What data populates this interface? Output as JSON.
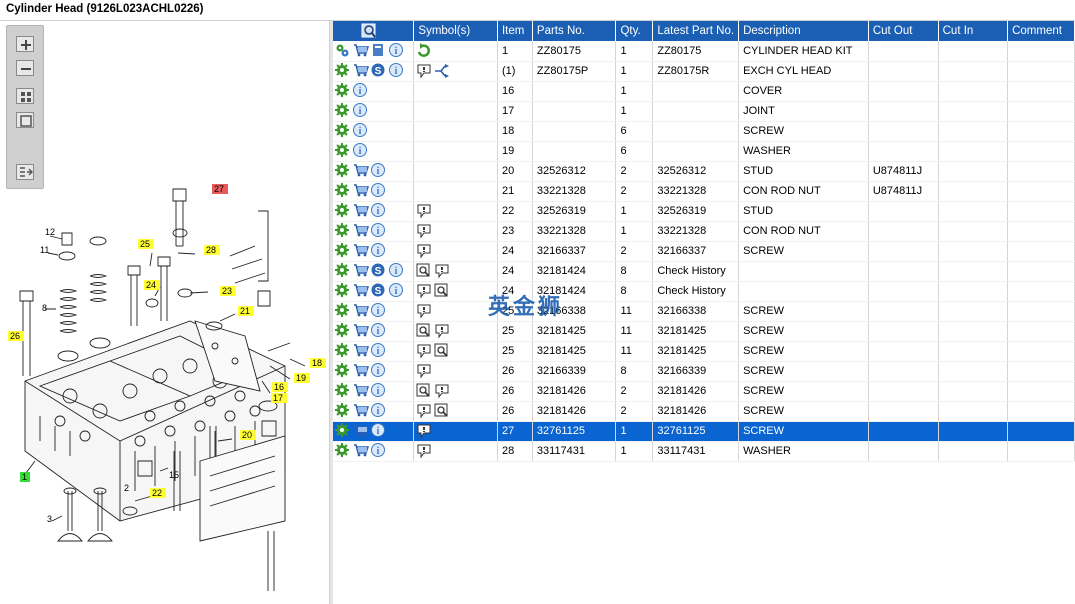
{
  "window": {
    "title": "Cylinder Head (9126L023ACHL0226)"
  },
  "toolbar": {
    "buttons": [
      {
        "name": "zoom-in-icon"
      },
      {
        "name": "zoom-out-icon"
      },
      {
        "name": "fit-all-icon"
      },
      {
        "name": "fit-window-icon"
      },
      {
        "name": "toggle-list-icon"
      }
    ]
  },
  "diagram": {
    "callouts": [
      {
        "label": "27",
        "color": "#e55a5a"
      },
      {
        "label": "12",
        "color": "none"
      },
      {
        "label": "11",
        "color": "none"
      },
      {
        "label": "25",
        "color": "#ffff33"
      },
      {
        "label": "28",
        "color": "#ffff33"
      },
      {
        "label": "24",
        "color": "#ffff33"
      },
      {
        "label": "23",
        "color": "#ffff33"
      },
      {
        "label": "8",
        "color": "none"
      },
      {
        "label": "21",
        "color": "#ffff33"
      },
      {
        "label": "26",
        "color": "#ffff33"
      },
      {
        "label": "18",
        "color": "#ffff33"
      },
      {
        "label": "19",
        "color": "#ffff33"
      },
      {
        "label": "16",
        "color": "#ffff33"
      },
      {
        "label": "17",
        "color": "#ffff33"
      },
      {
        "label": "20",
        "color": "#ffff33"
      },
      {
        "label": "15",
        "color": "none"
      },
      {
        "label": "2",
        "color": "none"
      },
      {
        "label": "22",
        "color": "#ffff33"
      },
      {
        "label": "3",
        "color": "none"
      },
      {
        "label": "1",
        "color": "#33dd33"
      }
    ]
  },
  "grid": {
    "header_icon": "magnify-icon",
    "columns": [
      "Symbol(s)",
      "Item",
      "Parts No.",
      "Qty.",
      "Latest Part No.",
      "Description",
      "Cut Out",
      "Cut In",
      "Comment"
    ],
    "rows": [
      {
        "icons": [
          "gear-kit-icon",
          "cart-icon",
          "book-icon",
          "info-icon"
        ],
        "symbols": [
          "refresh-arrow-icon"
        ],
        "item": "1",
        "part": "ZZ80175",
        "qty": "1",
        "latest": "ZZ80175",
        "desc": "CYLINDER HEAD KIT",
        "cut_out": "",
        "cut_in": "",
        "comment": ""
      },
      {
        "icons": [
          "gear-icon",
          "cart-icon",
          "s-icon",
          "info-icon"
        ],
        "symbols": [
          "note-icon",
          "branch-arrow-icon"
        ],
        "item": "(1)",
        "part": "ZZ80175P",
        "qty": "1",
        "latest": "ZZ80175R",
        "desc": "EXCH CYL HEAD",
        "cut_out": "",
        "cut_in": "",
        "comment": ""
      },
      {
        "icons": [
          "gear-icon",
          "info-icon"
        ],
        "symbols": [],
        "item": "16",
        "part": "",
        "qty": "1",
        "latest": "",
        "desc": "COVER",
        "cut_out": "",
        "cut_in": "",
        "comment": ""
      },
      {
        "icons": [
          "gear-icon",
          "info-icon"
        ],
        "symbols": [],
        "item": "17",
        "part": "",
        "qty": "1",
        "latest": "",
        "desc": "JOINT",
        "cut_out": "",
        "cut_in": "",
        "comment": ""
      },
      {
        "icons": [
          "gear-icon",
          "info-icon"
        ],
        "symbols": [],
        "item": "18",
        "part": "",
        "qty": "6",
        "latest": "",
        "desc": "SCREW",
        "cut_out": "",
        "cut_in": "",
        "comment": ""
      },
      {
        "icons": [
          "gear-icon",
          "info-icon"
        ],
        "symbols": [],
        "item": "19",
        "part": "",
        "qty": "6",
        "latest": "",
        "desc": "WASHER",
        "cut_out": "",
        "cut_in": "",
        "comment": ""
      },
      {
        "icons": [
          "gear-icon",
          "cart-icon",
          "info-icon"
        ],
        "symbols": [],
        "item": "20",
        "part": "32526312",
        "qty": "2",
        "latest": "32526312",
        "desc": "STUD",
        "cut_out": "U874811J",
        "cut_in": "",
        "comment": ""
      },
      {
        "icons": [
          "gear-icon",
          "cart-icon",
          "info-icon"
        ],
        "symbols": [],
        "item": "21",
        "part": "33221328",
        "qty": "2",
        "latest": "33221328",
        "desc": "CON ROD NUT",
        "cut_out": "U874811J",
        "cut_in": "",
        "comment": ""
      },
      {
        "icons": [
          "gear-icon",
          "cart-icon",
          "info-icon"
        ],
        "symbols": [
          "note-icon"
        ],
        "item": "22",
        "part": "32526319",
        "qty": "1",
        "latest": "32526319",
        "desc": "STUD",
        "cut_out": "",
        "cut_in": "",
        "comment": ""
      },
      {
        "icons": [
          "gear-icon",
          "cart-icon",
          "info-icon"
        ],
        "symbols": [
          "note-icon"
        ],
        "item": "23",
        "part": "33221328",
        "qty": "1",
        "latest": "33221328",
        "desc": "CON ROD NUT",
        "cut_out": "",
        "cut_in": "",
        "comment": ""
      },
      {
        "icons": [
          "gear-icon",
          "cart-icon",
          "info-icon"
        ],
        "symbols": [
          "note-icon"
        ],
        "item": "24",
        "part": "32166337",
        "qty": "2",
        "latest": "32166337",
        "desc": "SCREW",
        "cut_out": "",
        "cut_in": "",
        "comment": ""
      },
      {
        "icons": [
          "gear-icon",
          "cart-icon",
          "s-icon",
          "info-icon"
        ],
        "symbols": [
          "search-note-icon",
          "note-icon"
        ],
        "item": "24",
        "part": "32181424",
        "qty": "8",
        "latest": "Check History",
        "desc": "",
        "cut_out": "",
        "cut_in": "",
        "comment": ""
      },
      {
        "icons": [
          "gear-icon",
          "cart-icon",
          "s-icon",
          "info-icon"
        ],
        "symbols": [
          "note-icon",
          "search-note-icon"
        ],
        "item": "24",
        "part": "32181424",
        "qty": "8",
        "latest": "Check History",
        "desc": "",
        "cut_out": "",
        "cut_in": "",
        "comment": ""
      },
      {
        "icons": [
          "gear-icon",
          "cart-icon",
          "info-icon"
        ],
        "symbols": [
          "note-icon"
        ],
        "item": "25",
        "part": "32166338",
        "qty": "11",
        "latest": "32166338",
        "desc": "SCREW",
        "cut_out": "",
        "cut_in": "",
        "comment": ""
      },
      {
        "icons": [
          "gear-icon",
          "cart-icon",
          "info-icon"
        ],
        "symbols": [
          "search-note-icon",
          "note-icon"
        ],
        "item": "25",
        "part": "32181425",
        "qty": "11",
        "latest": "32181425",
        "desc": "SCREW",
        "cut_out": "",
        "cut_in": "",
        "comment": ""
      },
      {
        "icons": [
          "gear-icon",
          "cart-icon",
          "info-icon"
        ],
        "symbols": [
          "note-icon",
          "search-note-icon"
        ],
        "item": "25",
        "part": "32181425",
        "qty": "11",
        "latest": "32181425",
        "desc": "SCREW",
        "cut_out": "",
        "cut_in": "",
        "comment": ""
      },
      {
        "icons": [
          "gear-icon",
          "cart-icon",
          "info-icon"
        ],
        "symbols": [
          "note-icon"
        ],
        "item": "26",
        "part": "32166339",
        "qty": "8",
        "latest": "32166339",
        "desc": "SCREW",
        "cut_out": "",
        "cut_in": "",
        "comment": ""
      },
      {
        "icons": [
          "gear-icon",
          "cart-icon",
          "info-icon"
        ],
        "symbols": [
          "search-note-icon",
          "note-icon"
        ],
        "item": "26",
        "part": "32181426",
        "qty": "2",
        "latest": "32181426",
        "desc": "SCREW",
        "cut_out": "",
        "cut_in": "",
        "comment": ""
      },
      {
        "icons": [
          "gear-icon",
          "cart-icon",
          "info-icon"
        ],
        "symbols": [
          "note-icon",
          "search-note-icon"
        ],
        "item": "26",
        "part": "32181426",
        "qty": "2",
        "latest": "32181426",
        "desc": "SCREW",
        "cut_out": "",
        "cut_in": "",
        "comment": ""
      },
      {
        "icons": [
          "gear-icon",
          "cart-icon",
          "info-icon"
        ],
        "symbols": [
          "note-icon"
        ],
        "item": "27",
        "part": "32761125",
        "qty": "1",
        "latest": "32761125",
        "desc": "SCREW",
        "cut_out": "",
        "cut_in": "",
        "comment": "",
        "selected": true
      },
      {
        "icons": [
          "gear-icon",
          "cart-icon",
          "info-icon"
        ],
        "symbols": [
          "note-icon"
        ],
        "item": "28",
        "part": "33117431",
        "qty": "1",
        "latest": "33117431",
        "desc": "WASHER",
        "cut_out": "",
        "cut_in": "",
        "comment": ""
      }
    ]
  },
  "watermark": {
    "text": "英金狮"
  },
  "colors": {
    "header": "#1a5fb4",
    "selected": "#0a64d2",
    "gear": "#3c9a2c",
    "cart": "#2c5fb0",
    "info": "#3b78c9"
  }
}
